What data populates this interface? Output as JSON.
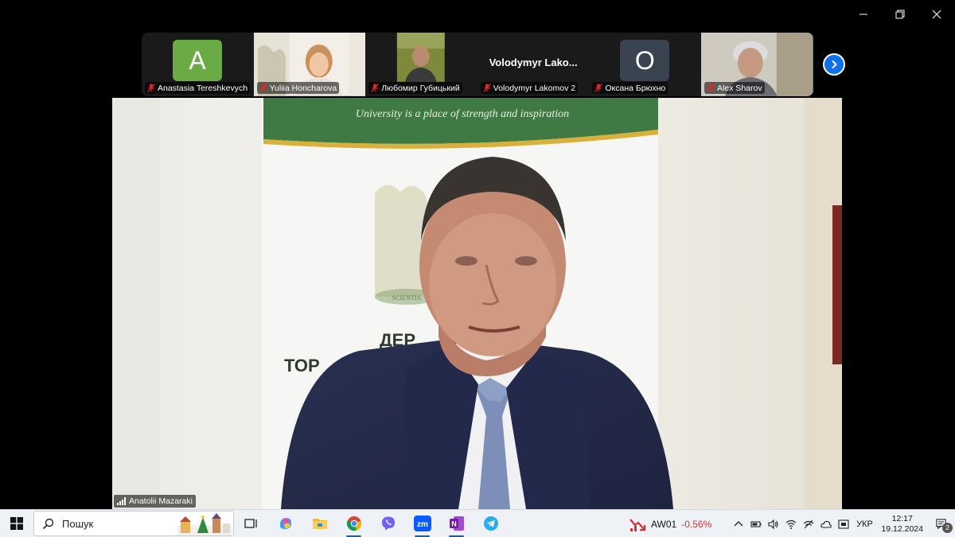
{
  "participants": [
    {
      "name": "Anastasia Tereshkevych",
      "initial": "A",
      "avatar_color": "#6aab45",
      "type": "avatar"
    },
    {
      "name": "Yuliia Honcharova",
      "type": "video"
    },
    {
      "name": "Любомир Губицький",
      "type": "video"
    },
    {
      "name": "Volodymyr Lakomov 2",
      "display": "Volodymyr  Lako...",
      "type": "name"
    },
    {
      "name": "Оксана Брюхно",
      "initial": "O",
      "avatar_color": "#3a4450",
      "type": "avatar"
    },
    {
      "name": "Alex Sharov",
      "type": "video"
    }
  ],
  "speaker": {
    "name": "Anatolii Mazaraki",
    "banner_text": "University is a place of strength and inspiration",
    "wall_text_1": "ДЕР",
    "wall_text_2": "ТОР",
    "emblem_text": "SCIENTIA"
  },
  "taskbar": {
    "search_placeholder": "Пошук",
    "stock_symbol": "AW01",
    "stock_change": "-0.56%",
    "language": "УКР",
    "time": "12:17",
    "date": "19.12.2024",
    "notification_count": "2"
  },
  "colors": {
    "zoom_blue": "#0e71eb",
    "stock_red": "#d13438",
    "banner_green": "#3f7a45"
  }
}
